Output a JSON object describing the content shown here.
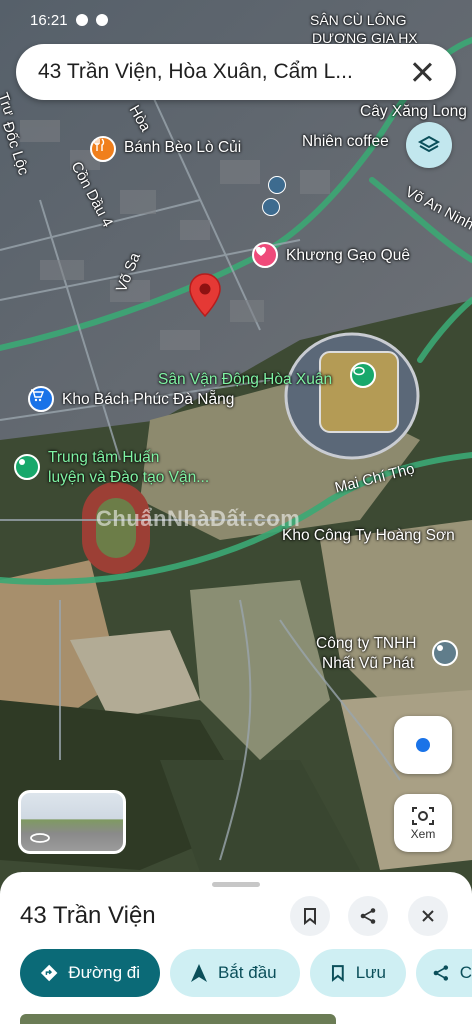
{
  "status_bar": {
    "time": "16:21"
  },
  "search": {
    "query": "43 Trần Viện, Hòa Xuân, Cẩm L..."
  },
  "map": {
    "streets": [
      "Võ Sa",
      "Cồn Dầu 4",
      "Mai Chí Thọ",
      "Võ An Ninh",
      "Hòa",
      "Trư",
      "Đốc Lộc"
    ],
    "places": [
      {
        "name": "Bánh Bèo Lò Củi",
        "type": "restaurant"
      },
      {
        "name": "Nhiên coffee",
        "type": "cafe"
      },
      {
        "name": "Cây Xăng Long",
        "type": "gas"
      },
      {
        "name": "Khương Gạo Quê",
        "type": "shop"
      },
      {
        "name": "Sân Vận Động Hòa Xuân",
        "type": "stadium"
      },
      {
        "name": "Kho Bách Phúc Đà Nẵng",
        "type": "store"
      },
      {
        "name": "Trung tâm Huấn",
        "name2": "luyện và Đào tạo Vận...",
        "type": "center"
      },
      {
        "name": "Kho Công Ty Hoàng Sơn",
        "type": "warehouse"
      },
      {
        "name": "Công ty TNHH",
        "name2": "Nhất Vũ Phát",
        "type": "company"
      },
      {
        "name": "SÂN CÙ LÔNG",
        "name2": "DƯƠNG GIA HX",
        "type": "venue"
      }
    ],
    "watermark": "ChuẩnNhàĐất.com",
    "pin_color": "#e53935"
  },
  "controls": {
    "xem_label": "Xem"
  },
  "sheet": {
    "title": "43 Trần Viện",
    "chips": [
      {
        "label": "Đường đi",
        "icon": "directions-icon"
      },
      {
        "label": "Bắt đầu",
        "icon": "navigation-icon"
      },
      {
        "label": "Lưu",
        "icon": "bookmark-icon"
      },
      {
        "label": "C",
        "icon": "share-icon"
      }
    ]
  },
  "colors": {
    "accent": "#0b6a77",
    "chip_bg": "#cfeff3",
    "road": "#3ba874"
  }
}
